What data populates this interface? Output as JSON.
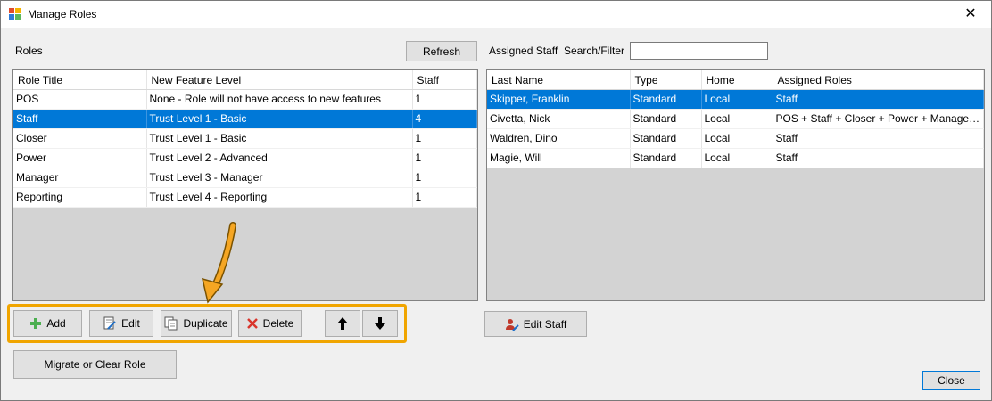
{
  "window": {
    "title": "Manage Roles",
    "close_glyph": "✕"
  },
  "roles_section": {
    "label": "Roles",
    "refresh_label": "Refresh",
    "columns": [
      "Role Title",
      "New Feature Level",
      "Staff"
    ],
    "rows": [
      {
        "title": "POS",
        "level": "None - Role will not have access to new features",
        "staff": "1",
        "selected": false
      },
      {
        "title": "Staff",
        "level": "Trust Level 1 - Basic",
        "staff": "4",
        "selected": true
      },
      {
        "title": "Closer",
        "level": "Trust Level 1 - Basic",
        "staff": "1",
        "selected": false
      },
      {
        "title": "Power",
        "level": "Trust Level 2 - Advanced",
        "staff": "1",
        "selected": false
      },
      {
        "title": "Manager",
        "level": "Trust Level 3 - Manager",
        "staff": "1",
        "selected": false
      },
      {
        "title": "Reporting",
        "level": "Trust Level 4 - Reporting",
        "staff": "1",
        "selected": false
      }
    ]
  },
  "staff_section": {
    "label": "Assigned Staff",
    "filter_label": "Search/Filter",
    "filter_value": "",
    "columns": [
      "Last Name",
      "Type",
      "Home",
      "Assigned Roles"
    ],
    "rows": [
      {
        "name": "Skipper, Franklin",
        "type": "Standard",
        "home": "Local",
        "roles": "Staff",
        "selected": true
      },
      {
        "name": "Civetta, Nick",
        "type": "Standard",
        "home": "Local",
        "roles": "POS + Staff + Closer + Power + Manager + Reporting",
        "selected": false
      },
      {
        "name": "Waldren, Dino",
        "type": "Standard",
        "home": "Local",
        "roles": "Staff",
        "selected": false
      },
      {
        "name": "Magie, Will",
        "type": "Standard",
        "home": "Local",
        "roles": "Staff",
        "selected": false
      }
    ]
  },
  "toolbar": {
    "add_label": "Add",
    "edit_label": "Edit",
    "duplicate_label": "Duplicate",
    "delete_label": "Delete",
    "migrate_label": "Migrate or Clear Role",
    "edit_staff_label": "Edit Staff",
    "close_label": "Close"
  },
  "colors": {
    "selection": "#0078d7",
    "highlight": "#f0a500"
  }
}
